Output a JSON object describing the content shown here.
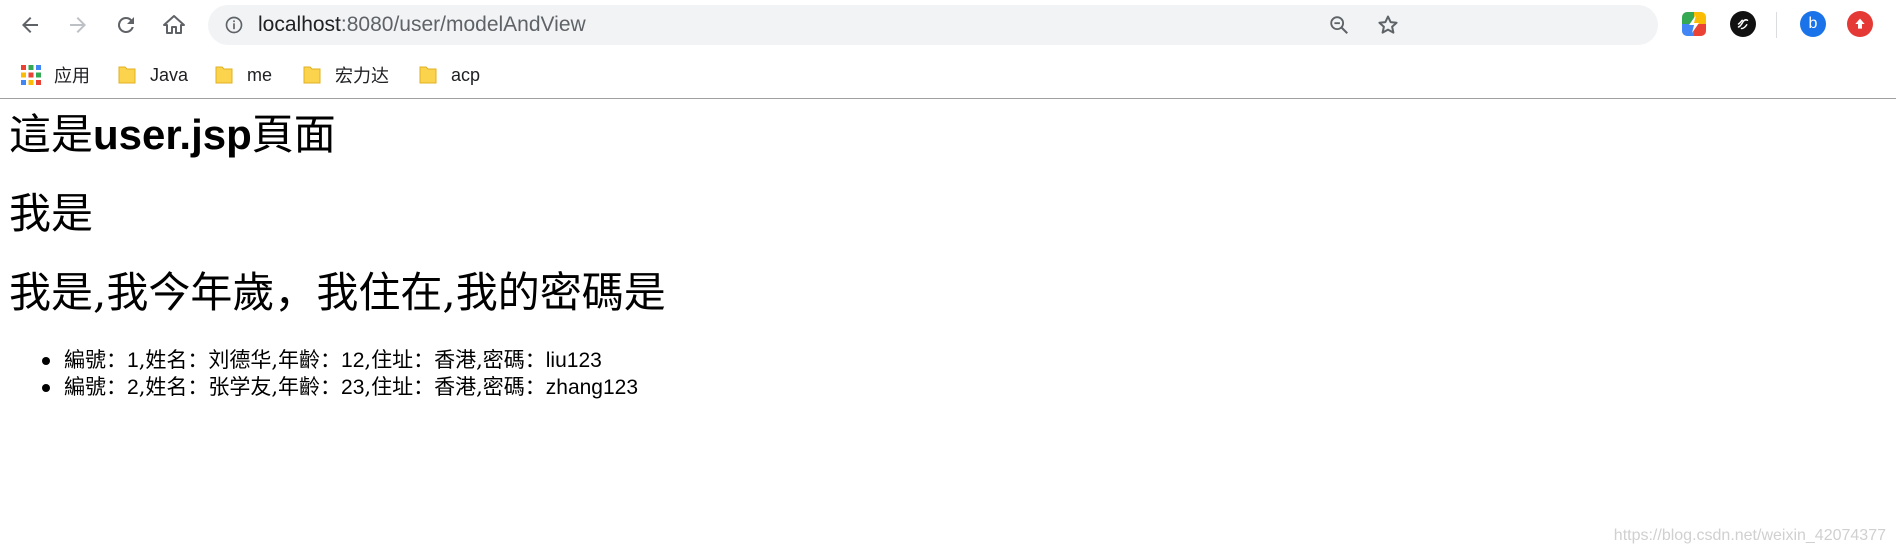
{
  "browser": {
    "url_host": "localhost",
    "url_path": ":8080/user/modelAndView",
    "extensions": [
      {
        "name": "b",
        "color": "#1a73e8"
      }
    ],
    "bookmarks": [
      {
        "label": "应用",
        "icon": "apps-grid-icon"
      },
      {
        "label": "Java",
        "icon": "folder-icon"
      },
      {
        "label": "me",
        "icon": "folder-icon"
      },
      {
        "label": "宏力达",
        "icon": "folder-icon"
      },
      {
        "label": "acp",
        "icon": "folder-icon"
      }
    ],
    "colors": {
      "omnibox_bg": "#f1f3f4",
      "folder": "#fcd34d",
      "divider": "#a0a0a0"
    }
  },
  "page": {
    "title_pre": "這是",
    "title_bold": "user.jsp",
    "title_post": "頁面",
    "line2": "我是",
    "line3": "我是,我今年歲，我住在,我的密碼是",
    "users": [
      {
        "text_a": "編號：",
        "id": "1",
        "text_b": ",姓名：刘德华,年齡：",
        "age": "12",
        "text_c": ",住址：香港,密碼：",
        "pwd": "liu123"
      },
      {
        "text_a": "編號：",
        "id": "2",
        "text_b": ",姓名：张学友,年齡：",
        "age": "23",
        "text_c": ",住址：香港,密碼：",
        "pwd": "zhang123"
      }
    ],
    "watermark": "https://blog.csdn.net/weixin_42074377"
  }
}
